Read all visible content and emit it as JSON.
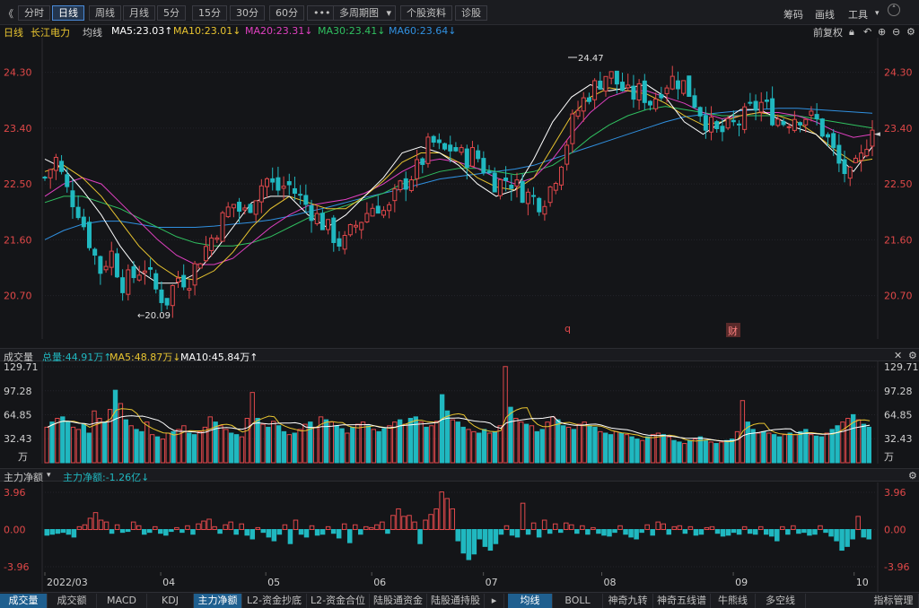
{
  "toolbar": {
    "collapse": "《",
    "periods": [
      "分时",
      "日线",
      "周线",
      "月线",
      "5分",
      "15分",
      "30分",
      "60分"
    ],
    "more": "•••",
    "multi": "多周期图",
    "multi_arrow": "▾",
    "profile": "个股资料",
    "diagnose": "诊股",
    "right": [
      "筹码",
      "画线",
      "工具"
    ],
    "tools_arrow": "▾"
  },
  "info": {
    "period": "日线",
    "stock": "长江电力",
    "ma_label": "均线",
    "ma5": "MA5:23.03↑",
    "ma10": "MA10:23.01↓",
    "ma20": "MA20:23.31↓",
    "ma30": "MA30:23.41↓",
    "ma60": "MA60:23.64↓",
    "adjust": "前复权"
  },
  "volume_bar": {
    "title": "成交量",
    "total": "总量:44.91万↑",
    "ma5": "MA5:48.87万↓",
    "ma10": "MA10:45.84万↑"
  },
  "flow_bar": {
    "title": "主力净额",
    "arrow": "▾",
    "value": "主力净额:-1.26亿↓"
  },
  "markers": {
    "q": "q",
    "cai": "财"
  },
  "bottom_tabs": [
    "成交量",
    "成交额",
    "MACD",
    "KDJ",
    "主力净额",
    "L2-资金抄底",
    "L2-资金合位",
    "陆股通资金",
    "陆股通持股",
    "均线",
    "BOLL",
    "神奇九转",
    "神奇五线谱",
    "牛熊线",
    "多空线",
    "指标管理"
  ],
  "colors": {
    "up": "#e0484b",
    "down": "#20b8c0",
    "ma5": "#ffffff",
    "ma10": "#e8c430",
    "ma20": "#e040c0",
    "ma30": "#30c060",
    "ma60": "#3090e0",
    "axis_text": "#e04848"
  },
  "chart_data": [
    {
      "type": "candlestick",
      "name": "price",
      "yticks": [
        "24.30",
        "23.40",
        "22.50",
        "21.60",
        "20.70"
      ],
      "ylim": [
        20.0,
        24.8
      ],
      "x_labels": [
        "2022/03",
        "04",
        "05",
        "06",
        "07",
        "08",
        "09",
        "10"
      ],
      "high_annotation": "24.47",
      "low_annotation": "←20.09",
      "last_price_marker": "◄",
      "ma_series": [
        "MA5",
        "MA10",
        "MA20",
        "MA30",
        "MA60"
      ],
      "close_path": [
        22.6,
        22.9,
        22.4,
        22.1,
        21.6,
        21.1,
        21.4,
        20.9,
        21.0,
        21.2,
        20.8,
        20.6,
        21.0,
        20.95,
        21.3,
        21.6,
        21.9,
        22.2,
        22.0,
        22.3,
        22.6,
        22.4,
        22.5,
        22.3,
        22.1,
        21.9,
        21.7,
        21.5,
        21.8,
        22.0,
        22.2,
        22.0,
        22.4,
        22.6,
        22.8,
        23.2,
        23.0,
        23.1,
        22.9,
        23.0,
        22.7,
        22.5,
        22.6,
        22.4,
        22.3,
        22.2,
        22.5,
        23.0,
        23.6,
        23.9,
        24.1,
        24.3,
        24.1,
        23.9,
        24.0,
        23.8,
        24.1,
        24.2,
        24.1,
        23.8,
        23.5,
        23.3,
        23.4,
        23.5,
        23.7,
        23.8,
        23.6,
        23.5,
        23.6,
        23.6,
        23.5,
        23.2,
        22.8,
        22.6,
        22.9,
        23.5
      ],
      "ma5_path": [
        22.9,
        22.75,
        22.4,
        22.0,
        21.5,
        21.1,
        20.9,
        20.9,
        21.05,
        21.4,
        21.8,
        22.2,
        22.3,
        22.3,
        22.0,
        21.8,
        22.0,
        22.3,
        22.6,
        23.0,
        23.1,
        23.0,
        22.8,
        22.5,
        22.3,
        22.4,
        22.9,
        23.5,
        23.9,
        24.1,
        24.0,
        24.05,
        24.1,
        23.9,
        23.5,
        23.3,
        23.5,
        23.7,
        23.7,
        23.55,
        23.4,
        23.3,
        23.0,
        22.7,
        23.1
      ],
      "ma10_path": [
        22.7,
        22.8,
        22.6,
        22.3,
        21.9,
        21.5,
        21.2,
        21.0,
        20.95,
        21.1,
        21.4,
        21.8,
        22.1,
        22.3,
        22.2,
        22.1,
        22.1,
        22.3,
        22.55,
        22.85,
        23.0,
        23.0,
        22.85,
        22.6,
        22.45,
        22.4,
        22.6,
        23.1,
        23.6,
        23.9,
        24.05,
        24.0,
        23.95,
        23.8,
        23.6,
        23.45,
        23.5,
        23.6,
        23.65,
        23.6,
        23.5,
        23.3,
        23.05,
        22.85,
        22.9
      ],
      "ma20_path": [
        22.3,
        22.5,
        22.6,
        22.5,
        22.2,
        21.9,
        21.6,
        21.35,
        21.2,
        21.2,
        21.3,
        21.55,
        21.8,
        22.0,
        22.15,
        22.2,
        22.25,
        22.35,
        22.5,
        22.7,
        22.85,
        22.9,
        22.85,
        22.75,
        22.6,
        22.5,
        22.6,
        22.9,
        23.3,
        23.65,
        23.9,
        24.0,
        24.0,
        23.9,
        23.8,
        23.65,
        23.55,
        23.6,
        23.65,
        23.65,
        23.6,
        23.5,
        23.35,
        23.25,
        23.3
      ],
      "ma30_path": [
        22.2,
        22.3,
        22.3,
        22.2,
        22.1,
        21.95,
        21.8,
        21.65,
        21.55,
        21.5,
        21.5,
        21.55,
        21.65,
        21.8,
        21.95,
        22.05,
        22.15,
        22.25,
        22.35,
        22.5,
        22.6,
        22.7,
        22.75,
        22.75,
        22.7,
        22.65,
        22.7,
        22.8,
        23.0,
        23.25,
        23.45,
        23.6,
        23.7,
        23.75,
        23.7,
        23.65,
        23.6,
        23.6,
        23.6,
        23.6,
        23.6,
        23.55,
        23.5,
        23.45,
        23.4
      ],
      "ma60_path": [
        21.6,
        21.75,
        21.85,
        21.9,
        21.9,
        21.85,
        21.8,
        21.8,
        21.8,
        21.82,
        21.85,
        21.88,
        21.92,
        21.98,
        22.05,
        22.12,
        22.2,
        22.28,
        22.35,
        22.42,
        22.5,
        22.58,
        22.62,
        22.66,
        22.7,
        22.74,
        22.8,
        22.9,
        23.0,
        23.1,
        23.2,
        23.3,
        23.4,
        23.5,
        23.58,
        23.62,
        23.65,
        23.68,
        23.7,
        23.72,
        23.72,
        23.7,
        23.68,
        23.66,
        23.64
      ]
    },
    {
      "type": "bar",
      "name": "volume",
      "unit": "万",
      "yticks": [
        "129.71",
        "97.28",
        "64.85",
        "32.43"
      ],
      "ylim": [
        0,
        129.71
      ],
      "values": [
        48,
        55,
        60,
        62,
        55,
        48,
        45,
        52,
        40,
        70,
        60,
        55,
        72,
        98,
        80,
        58,
        50,
        45,
        42,
        55,
        38,
        35,
        32,
        40,
        42,
        45,
        50,
        40,
        38,
        42,
        48,
        62,
        55,
        50,
        45,
        40,
        38,
        35,
        60,
        95,
        60,
        52,
        48,
        56,
        50,
        42,
        38,
        40,
        45,
        52,
        55,
        48,
        62,
        58,
        55,
        50,
        46,
        40,
        48,
        52,
        55,
        50,
        45,
        42,
        46,
        50,
        55,
        58,
        52,
        60,
        62,
        55,
        48,
        50,
        56,
        92,
        70,
        58,
        55,
        48,
        45,
        42,
        40,
        45,
        40,
        42,
        50,
        130,
        75,
        60,
        55,
        52,
        50,
        42,
        45,
        55,
        62,
        58,
        50,
        48,
        45,
        52,
        55,
        50,
        48,
        42,
        40,
        38,
        42,
        40,
        38,
        35,
        32,
        30,
        35,
        38,
        40,
        38,
        35,
        30,
        28,
        26,
        30,
        32,
        35,
        30,
        28,
        26,
        28,
        30,
        32,
        42,
        84,
        55,
        45,
        40,
        42,
        40,
        38,
        35,
        38,
        40,
        38,
        42,
        45,
        38,
        36,
        35,
        40,
        45,
        50,
        55,
        60,
        65,
        58,
        52,
        48
      ],
      "up_flags": [
        1,
        0,
        1,
        0,
        0,
        1,
        1,
        0,
        0,
        1,
        1,
        0,
        1,
        0,
        1,
        0,
        1,
        0,
        0,
        1,
        1,
        0,
        1,
        1,
        0,
        1,
        1,
        0,
        0,
        1,
        1,
        1,
        0,
        1,
        1,
        0,
        0,
        1,
        1,
        1,
        0,
        1,
        0,
        1,
        0,
        0,
        1,
        0,
        1,
        1,
        0,
        1,
        1,
        0,
        1,
        0,
        0,
        1,
        0,
        1,
        1,
        0,
        1,
        0,
        0,
        1,
        1,
        0,
        1,
        0,
        0,
        1,
        0,
        1,
        1,
        0,
        0,
        1,
        0,
        0,
        1,
        1,
        0,
        0,
        1,
        0,
        1,
        1,
        0,
        1,
        1,
        0,
        1,
        0,
        0,
        1,
        1,
        0,
        0,
        1,
        0,
        1,
        1,
        0,
        0,
        1,
        0,
        0,
        1,
        0,
        1,
        0,
        0,
        1,
        0,
        1,
        1,
        0,
        1,
        0,
        0,
        1,
        0,
        1,
        0,
        0,
        1,
        0,
        1,
        0,
        0,
        1,
        1,
        0,
        0,
        1,
        0,
        1,
        0,
        0,
        1,
        0,
        1,
        0,
        0,
        1,
        0,
        0,
        1,
        0,
        0,
        1,
        1,
        0,
        1,
        0,
        0
      ]
    },
    {
      "type": "bar",
      "name": "main_net_flow",
      "unit": "亿",
      "yticks": [
        "3.96",
        "0.00",
        "-3.96"
      ],
      "ylim": [
        -3.96,
        3.96
      ],
      "values": [
        -0.6,
        -0.5,
        -0.4,
        -0.3,
        -0.5,
        -0.8,
        0.3,
        0.5,
        1.2,
        1.8,
        1.0,
        0.8,
        -0.4,
        0.5,
        -0.3,
        -0.2,
        0.8,
        0.4,
        -0.5,
        -0.3,
        0.3,
        -0.4,
        -0.6,
        -0.2,
        0.2,
        -0.3,
        0.4,
        -0.5,
        0.6,
        0.9,
        1.1,
        0.3,
        -0.4,
        0.5,
        0.8,
        -0.5,
        0.6,
        -0.6,
        -1.0,
        0.2,
        -0.3,
        -0.8,
        -1.2,
        -0.5,
        0.5,
        -1.5,
        1.0,
        -0.5,
        -0.8,
        0.4,
        -0.6,
        -0.5,
        0.3,
        -0.4,
        -0.9,
        0.6,
        -1.4,
        0.5,
        -0.5,
        0.3,
        0.2,
        0.5,
        0.8,
        -0.4,
        1.5,
        2.2,
        1.4,
        1.5,
        0.8,
        -1.5,
        1.0,
        1.6,
        2.2,
        4.0,
        3.3,
        2.2,
        -1.2,
        -2.5,
        -3.2,
        -2.6,
        -1.0,
        -1.8,
        -2.2,
        -1.5,
        -0.5,
        0.4,
        -0.6,
        -0.8,
        2.8,
        -0.5,
        0.7,
        -0.8,
        1.0,
        -0.4,
        0.6,
        -0.3,
        0.7,
        0.5,
        -0.4,
        0.4,
        -0.5,
        0.2,
        -0.4,
        -0.6,
        -0.7,
        -0.3,
        0.4,
        -0.5,
        -0.8,
        -1.0,
        -0.3,
        0.5,
        -0.6,
        0.8,
        0.6,
        -0.5,
        0.3,
        0.4,
        -0.4,
        0.3,
        -0.6,
        -0.5,
        0.2,
        0.3,
        -0.4,
        -0.7,
        -0.6,
        -0.3,
        -0.5,
        0.3,
        -0.4,
        -0.5,
        0.3,
        -0.5,
        -0.7,
        -1.2,
        0.3,
        -0.5,
        0.4,
        -0.4,
        -0.3,
        -0.6,
        -0.5,
        0.4,
        -0.3,
        -0.7,
        -1.2,
        -2.2,
        -1.8,
        -1.0,
        1.4,
        -0.8,
        -1.0
      ]
    }
  ]
}
